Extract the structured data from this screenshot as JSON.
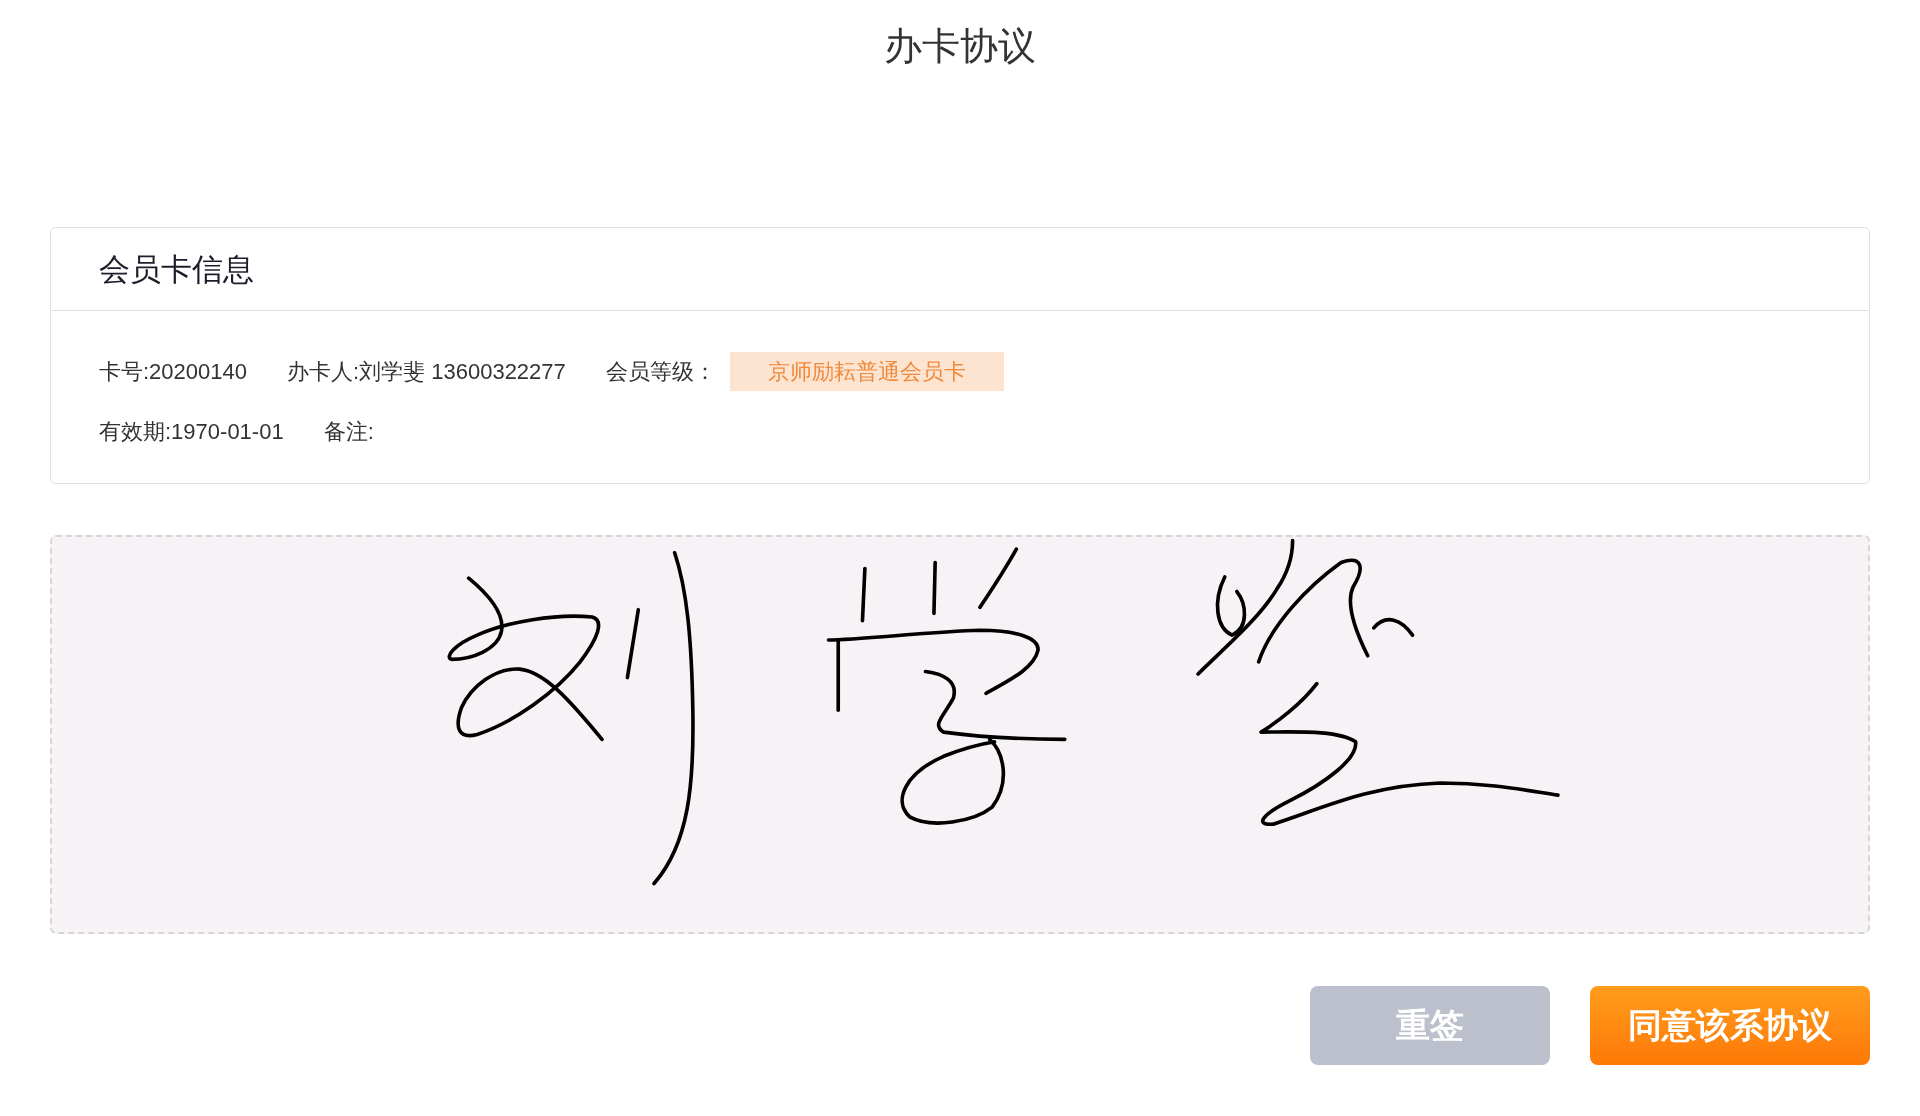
{
  "header": {
    "title": "办卡协议"
  },
  "member_card": {
    "title": "会员卡信息",
    "rows": [
      [
        {
          "text": "卡号:20200140"
        },
        {
          "text": "办卡人:刘学斐 13600322277"
        },
        {
          "text": "会员等级：",
          "tag": "京师励耘普通会员卡"
        }
      ],
      [
        {
          "text": "有效期:1970-01-01"
        },
        {
          "text": "备注:"
        }
      ]
    ]
  },
  "buttons": [
    {
      "label": "重签",
      "kind": "secondary"
    },
    {
      "label": "同意该系协议",
      "kind": "primary"
    }
  ]
}
